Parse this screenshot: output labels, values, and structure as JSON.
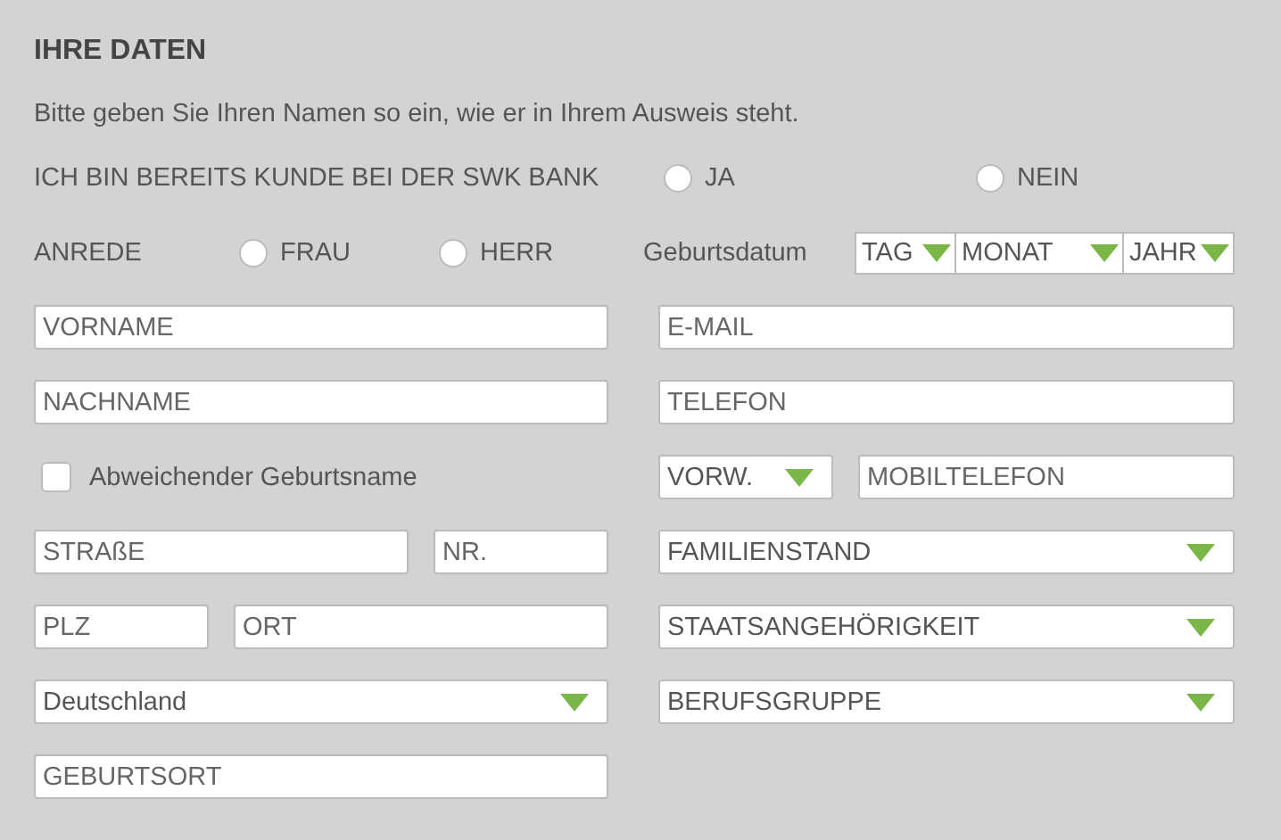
{
  "section": {
    "title": "IHRE DATEN",
    "intro": "Bitte geben Sie Ihren Namen so ein, wie er in Ihrem Ausweis steht."
  },
  "customer": {
    "label": "ICH BIN BEREITS KUNDE BEI DER SWK BANK",
    "options": [
      {
        "label": "JA",
        "selected": false
      },
      {
        "label": "NEIN",
        "selected": false
      }
    ]
  },
  "salutation": {
    "label": "ANREDE",
    "options": [
      {
        "label": "FRAU",
        "selected": false
      },
      {
        "label": "HERR",
        "selected": false
      }
    ]
  },
  "birthdate": {
    "label": "Geburtsdatum",
    "selects": [
      {
        "value": "TAG"
      },
      {
        "value": "MONAT"
      },
      {
        "value": "JAHR"
      }
    ]
  },
  "left_rows": [
    [
      {
        "kind": "text",
        "placeholder": "VORNAME"
      }
    ],
    [
      {
        "kind": "text",
        "placeholder": "NACHNAME"
      }
    ],
    [
      {
        "kind": "checkbox",
        "label": "Abweichender Geburtsname",
        "checked": false
      }
    ],
    [
      {
        "kind": "text",
        "placeholder": "STRAßE"
      },
      {
        "kind": "text",
        "placeholder": "NR."
      }
    ],
    [
      {
        "kind": "text",
        "placeholder": "PLZ"
      },
      {
        "kind": "text",
        "placeholder": "ORT"
      }
    ],
    [
      {
        "kind": "select",
        "value": "Deutschland"
      }
    ],
    [
      {
        "kind": "text",
        "placeholder": "GEBURTSORT"
      }
    ]
  ],
  "right_rows": [
    [
      {
        "kind": "text",
        "placeholder": "E-MAIL"
      }
    ],
    [
      {
        "kind": "text",
        "placeholder": "TELEFON"
      }
    ],
    [
      {
        "kind": "select",
        "value": "VORW."
      },
      {
        "kind": "text",
        "placeholder": "MOBILTELEFON"
      }
    ],
    [
      {
        "kind": "select",
        "value": "FAMILIENSTAND"
      }
    ],
    [
      {
        "kind": "select",
        "value": "STAATSANGEHÖRIGKEIT"
      }
    ],
    [
      {
        "kind": "select",
        "value": "BERUFSGRUPPE"
      }
    ]
  ]
}
